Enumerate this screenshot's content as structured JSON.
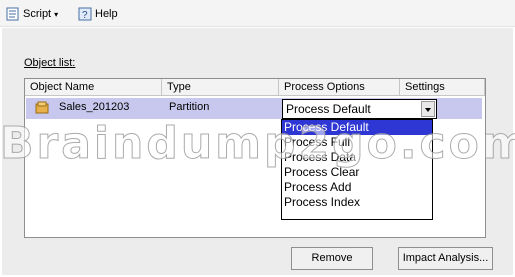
{
  "toolbar": {
    "script_label": "Script",
    "help_label": "Help"
  },
  "object_list_label": "Object list:",
  "grid": {
    "headers": [
      "Object Name",
      "Type",
      "Process Options",
      "Settings"
    ],
    "row": {
      "name": "Sales_201203",
      "type": "Partition",
      "process_option": "Process Default"
    }
  },
  "dropdown_options": [
    "Process Default",
    "Process Full",
    "Process Data",
    "Process Clear",
    "Process Add",
    "Process Index"
  ],
  "selected_option_index": 0,
  "watermark": "Braindump2go.com",
  "buttons": {
    "remove": "Remove",
    "impact": "Impact Analysis..."
  }
}
